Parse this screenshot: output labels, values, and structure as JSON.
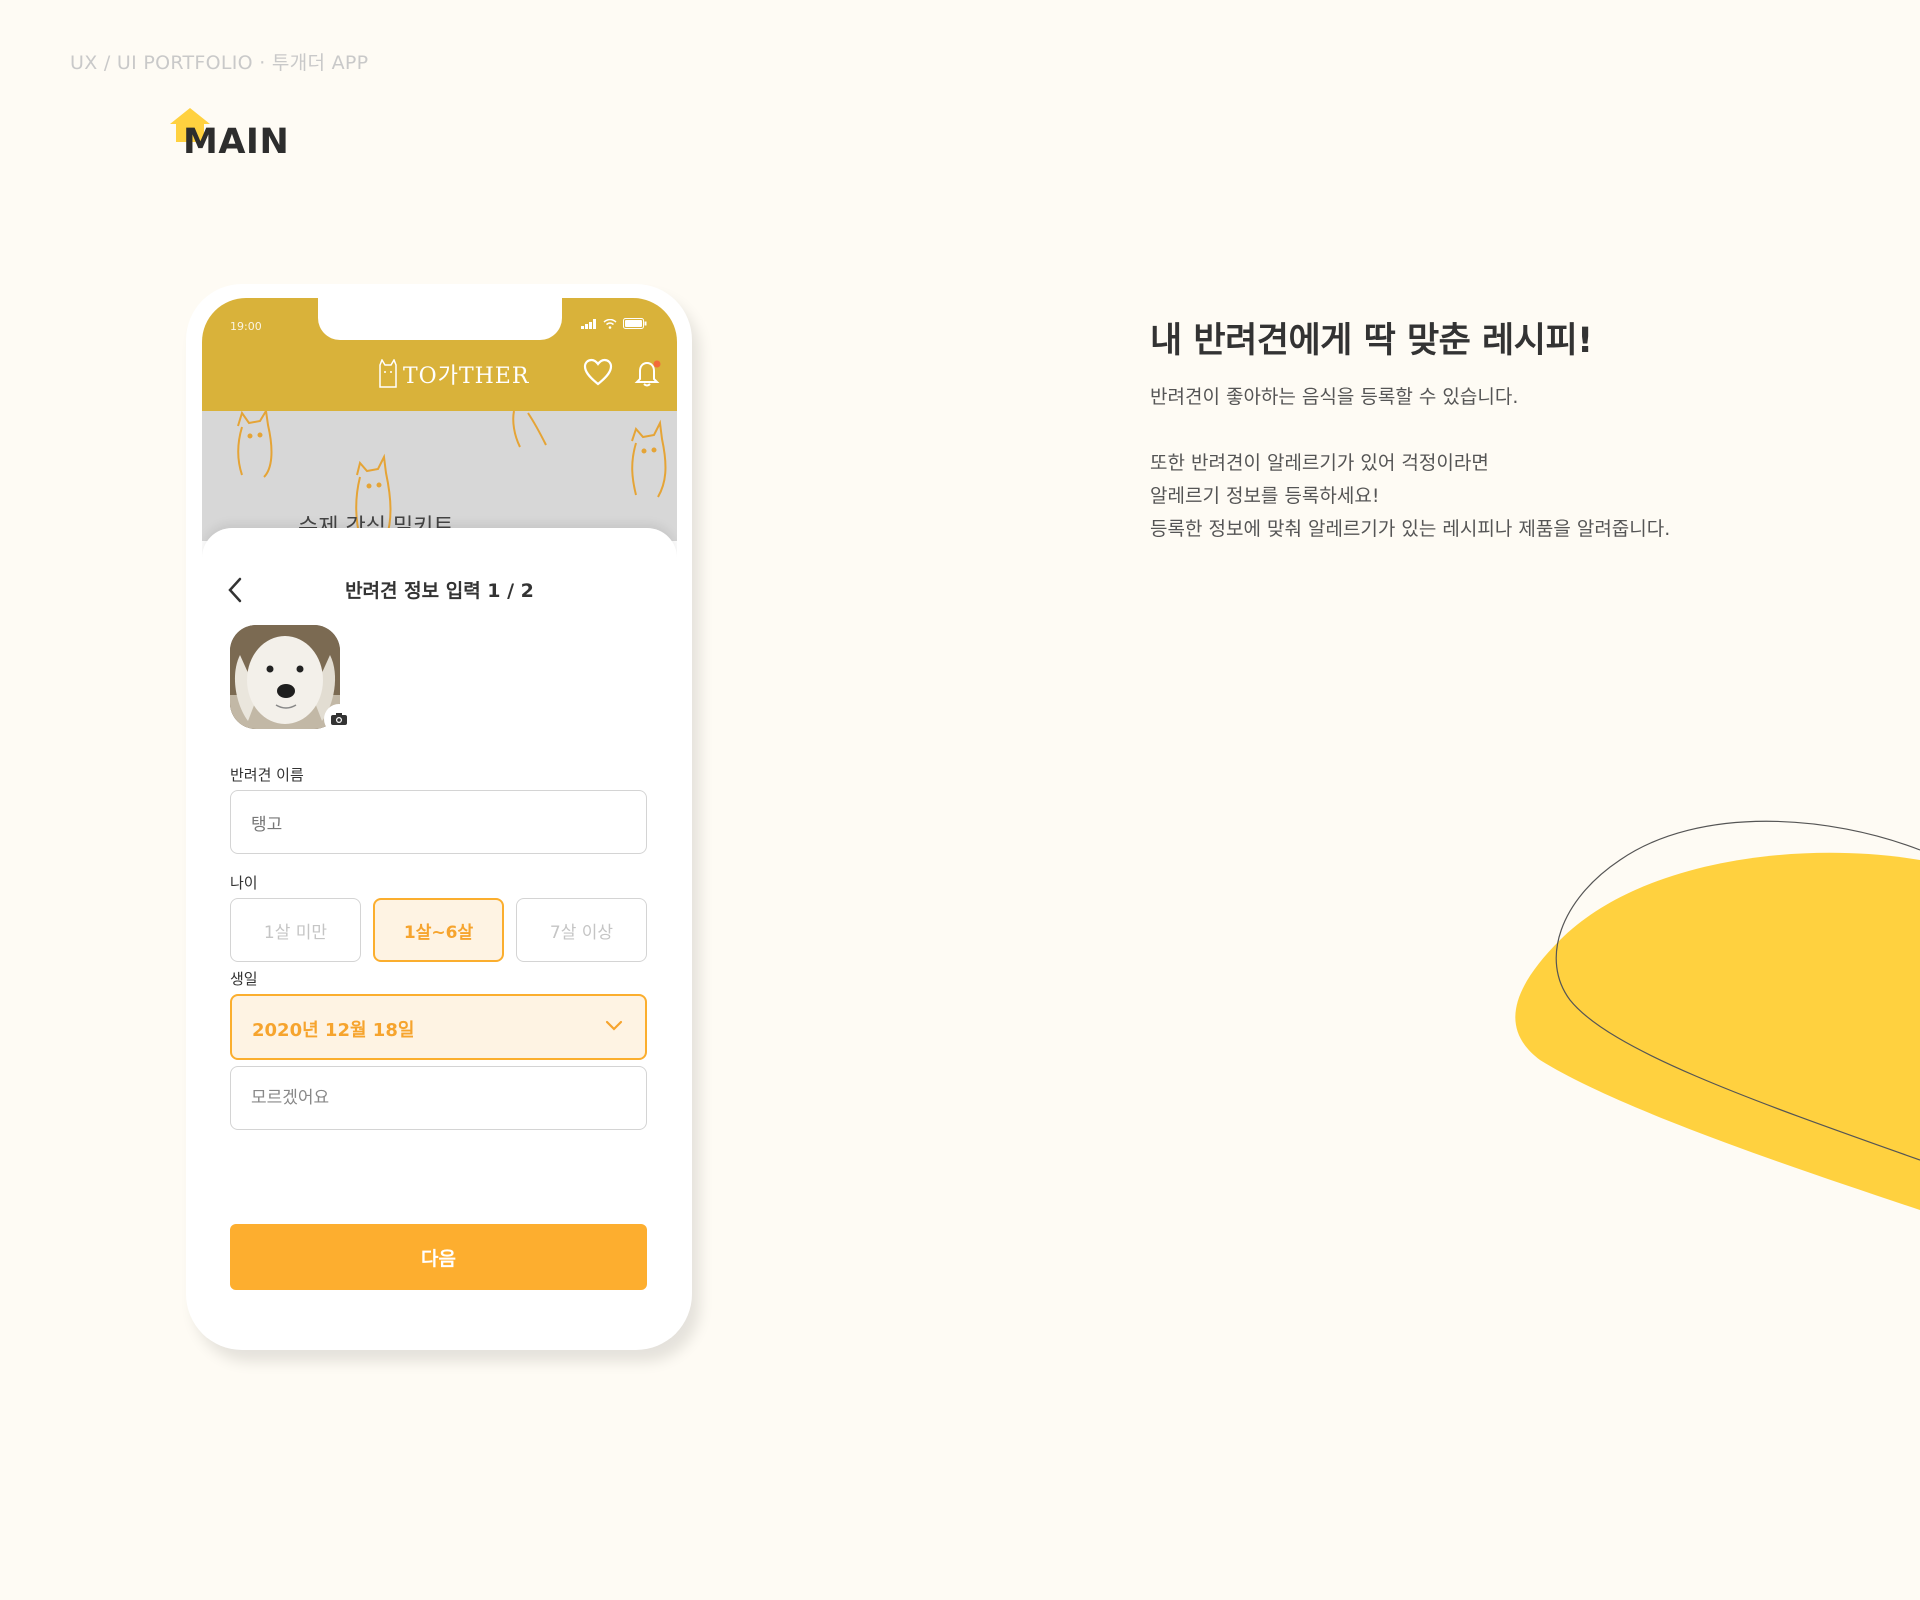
{
  "header": {
    "portfolio_label": "UX / UI PORTFOLIO · 투개더 APP",
    "section_title": "MAIN"
  },
  "description": {
    "headline": "내 반려견에게 딱 맞춘 레시피!",
    "paragraph1": "반려견이 좋아하는 음식을 등록할 수 있습니다.",
    "paragraph2_lines": [
      "또한 반려견이 알레르기가 있어 걱정이라면",
      "알레르기 정보를 등록하세요!",
      "등록한 정보에 맞춰 알레르기가 있는 레시피나 제품을 알려줍니다."
    ]
  },
  "colors": {
    "background": "#FEFBF4",
    "app_bar": "#D9B23A",
    "accent": "#FDAE2F",
    "blob": "#FFD13F",
    "selected_fill": "#FEF3E3"
  },
  "phone": {
    "status_time": "19:00",
    "app_logo": "TO가THER",
    "top_icons": [
      "heart-icon",
      "bell-icon"
    ],
    "banner_text": "수제 간식 밀키트",
    "sheet": {
      "title": "반려견 정보 입력 1 / 2",
      "back_icon": "chevron-left-icon",
      "photo_badge_icon": "camera-icon",
      "name_label": "반려견 이름",
      "name_value": "탱고",
      "age_label": "나이",
      "age_options": [
        "1살 미만",
        "1살~6살",
        "7살 이상"
      ],
      "age_selected": "1살~6살",
      "birthday_label": "생일",
      "birthday_value": "2020년 12월 18일",
      "unknown_placeholder": "모르겠어요",
      "next_button": "다음"
    }
  }
}
